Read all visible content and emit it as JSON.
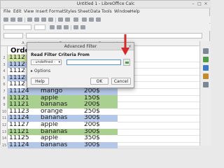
{
  "window": {
    "title": "Untitled 1 - LibreOffice Calc"
  },
  "menu": [
    "File",
    "Edit",
    "View",
    "Insert",
    "Format",
    "Styles",
    "Sheet",
    "Data",
    "Tools",
    "Window",
    "Help"
  ],
  "sheet": {
    "columns": [
      "A",
      "B",
      "C"
    ],
    "header_visible": "Orde",
    "rows": [
      {
        "num": "2",
        "id": "1112",
        "item": "",
        "price": "",
        "color": "#cfe2a2"
      },
      {
        "num": "3",
        "id": "1112",
        "item": "",
        "price": "",
        "color": "#b4c7e7"
      },
      {
        "num": "4",
        "id": "1112",
        "item": "",
        "price": "",
        "color": "#ffffff"
      },
      {
        "num": "5",
        "id": "1112",
        "item": "",
        "price": "",
        "color": "#b4c7e7"
      },
      {
        "num": "6",
        "id": "1112",
        "item": "",
        "price": "",
        "color": "#ffffff"
      },
      {
        "num": "7",
        "id": "11124",
        "item": "mango",
        "price": "200$",
        "color": "#b4c7e7"
      },
      {
        "num": "8",
        "id": "11121",
        "item": "apple",
        "price": "150$",
        "color": "#a9d08e"
      },
      {
        "num": "9",
        "id": "11121",
        "item": "bananas",
        "price": "200$",
        "color": "#a9d08e"
      },
      {
        "num": "10",
        "id": "11123",
        "item": "orange",
        "price": "250$",
        "color": "#ffffff"
      },
      {
        "num": "11",
        "id": "11124",
        "item": "bananas",
        "price": "300$",
        "color": "#b4c7e7"
      },
      {
        "num": "12",
        "id": "11127",
        "item": "apple",
        "price": "200$",
        "color": "#ffffff"
      },
      {
        "num": "13",
        "id": "11121",
        "item": "bananas",
        "price": "300$",
        "color": "#a9d08e"
      },
      {
        "num": "14",
        "id": "11125",
        "item": "apple",
        "price": "350$",
        "color": "#ffffff"
      },
      {
        "num": "15",
        "id": "11124",
        "item": "bananas",
        "price": "300$",
        "color": "#b4c7e7"
      }
    ]
  },
  "dialog": {
    "title": "Advanced Filter",
    "read_label": "Read Filter Criteria From",
    "range_select": "- undefined -",
    "range_value": "",
    "options_label": "Options",
    "help_label": "Help",
    "ok_label": "OK",
    "cancel_label": "Cancel"
  },
  "colors": {
    "arrow": "#d62a2a",
    "accent": "#5a8fd6"
  }
}
